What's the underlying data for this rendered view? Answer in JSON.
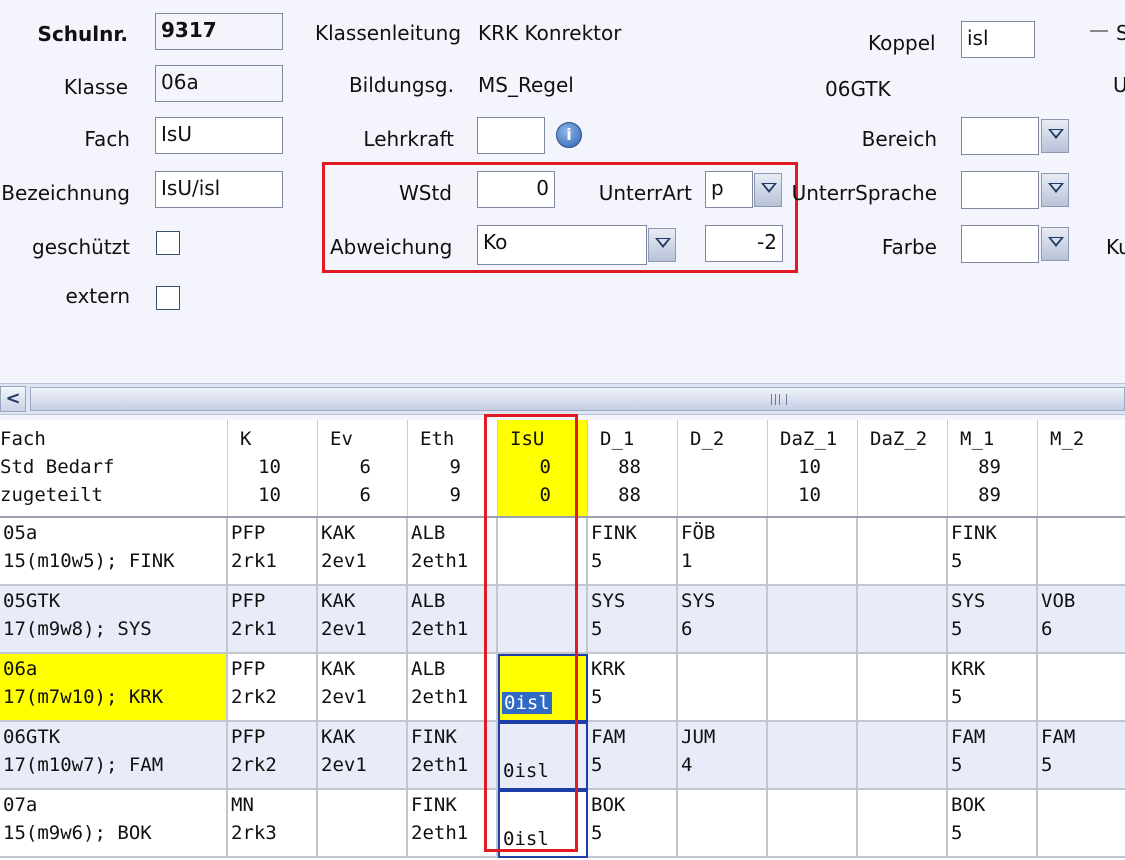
{
  "form": {
    "schulnr_label": "Schulnr.",
    "schulnr_value": "9317",
    "klasse_label": "Klasse",
    "klasse_value": "06a",
    "fach_label": "Fach",
    "fach_value": "IsU",
    "bezeichnung_label": "Bezeichnung",
    "bezeichnung_value": "IsU/isl",
    "geschuetzt_label": "geschützt",
    "extern_label": "extern",
    "klassenleitung_label": "Klassenleitung",
    "klassenleitung_value": "KRK Konrektor",
    "bildungsg_label": "Bildungsg.",
    "bildungsg_value": "MS_Regel",
    "lehrkraft_label": "Lehrkraft",
    "lehrkraft_value": "",
    "wstd_label": "WStd",
    "wstd_value": "0",
    "unterrart_label": "UnterrArt",
    "unterrart_value": "p",
    "abweichung_label": "Abweichung",
    "abweichung_value": "Ko",
    "abweichung_num": "-2",
    "koppel_label": "Koppel",
    "koppel_value": "isl",
    "gtk_text": "06GTK",
    "bereich_label": "Bereich",
    "unterrsprache_label": "UnterrSprache",
    "farbe_label": "Farbe",
    "cut_s": "S",
    "cut_u": "U",
    "cut_ku": "Ku"
  },
  "grid": {
    "row_labels": [
      "Fach",
      "Std Bedarf",
      "zugeteilt"
    ],
    "columns": [
      {
        "name": "K",
        "bedarf": "10",
        "zugeteilt": "10"
      },
      {
        "name": "Ev",
        "bedarf": "6",
        "zugeteilt": "6"
      },
      {
        "name": "Eth",
        "bedarf": "9",
        "zugeteilt": "9"
      },
      {
        "name": "IsU",
        "bedarf": "0",
        "zugeteilt": "0"
      },
      {
        "name": "D_1",
        "bedarf": "88",
        "zugeteilt": "88"
      },
      {
        "name": "D_2",
        "bedarf": "",
        "zugeteilt": ""
      },
      {
        "name": "DaZ_1",
        "bedarf": "10",
        "zugeteilt": "10"
      },
      {
        "name": "DaZ_2",
        "bedarf": "",
        "zugeteilt": ""
      },
      {
        "name": "M_1",
        "bedarf": "89",
        "zugeteilt": "89"
      },
      {
        "name": "M_2",
        "bedarf": "",
        "zugeteilt": ""
      }
    ],
    "rows": [
      {
        "klasse": "05a",
        "info": "15(m10w5); FINK",
        "cells": [
          [
            "PFP",
            "2rk1"
          ],
          [
            "KAK",
            "2ev1"
          ],
          [
            "ALB",
            "2eth1"
          ],
          [
            "",
            ""
          ],
          [
            "FINK",
            "5"
          ],
          [
            "FÖB",
            "1"
          ],
          [
            "",
            ""
          ],
          [
            "",
            ""
          ],
          [
            "FINK",
            "5"
          ],
          [
            "",
            ""
          ]
        ]
      },
      {
        "klasse": "05GTK",
        "info": "17(m9w8); SYS",
        "cells": [
          [
            "PFP",
            "2rk1"
          ],
          [
            "KAK",
            "2ev1"
          ],
          [
            "ALB",
            "2eth1"
          ],
          [
            "",
            ""
          ],
          [
            "SYS",
            "5"
          ],
          [
            "SYS",
            "6"
          ],
          [
            "",
            ""
          ],
          [
            "",
            ""
          ],
          [
            "SYS",
            "5"
          ],
          [
            "VOB",
            "6"
          ]
        ]
      },
      {
        "klasse": "06a",
        "info": "17(m7w10); KRK",
        "cells": [
          [
            "PFP",
            "2rk2"
          ],
          [
            "KAK",
            "2ev1"
          ],
          [
            "ALB",
            "2eth1"
          ],
          [
            "",
            "0isl"
          ],
          [
            "KRK",
            "5"
          ],
          [
            "",
            ""
          ],
          [
            "",
            ""
          ],
          [
            "",
            ""
          ],
          [
            "KRK",
            "5"
          ],
          [
            "",
            ""
          ]
        ]
      },
      {
        "klasse": "06GTK",
        "info": "17(m10w7); FAM",
        "cells": [
          [
            "PFP",
            "2rk2"
          ],
          [
            "KAK",
            "2ev1"
          ],
          [
            "FINK",
            "2eth1"
          ],
          [
            "",
            "0isl"
          ],
          [
            "FAM",
            "5"
          ],
          [
            "JUM",
            "4"
          ],
          [
            "",
            ""
          ],
          [
            "",
            ""
          ],
          [
            "FAM",
            "5"
          ],
          [
            "FAM",
            "5"
          ]
        ]
      },
      {
        "klasse": "07a",
        "info": "15(m9w6); BOK",
        "cells": [
          [
            "MN",
            "2rk3"
          ],
          [
            "",
            ""
          ],
          [
            "FINK",
            "2eth1"
          ],
          [
            "",
            "0isl"
          ],
          [
            "BOK",
            "5"
          ],
          [
            "",
            ""
          ],
          [
            "",
            ""
          ],
          [
            "",
            ""
          ],
          [
            "BOK",
            "5"
          ],
          [
            "",
            ""
          ]
        ]
      }
    ]
  },
  "colors": {
    "highlight": "#ffff00",
    "red": "#e01b24",
    "selection": "#316ac5",
    "row_alt": "#e8ecf8"
  }
}
